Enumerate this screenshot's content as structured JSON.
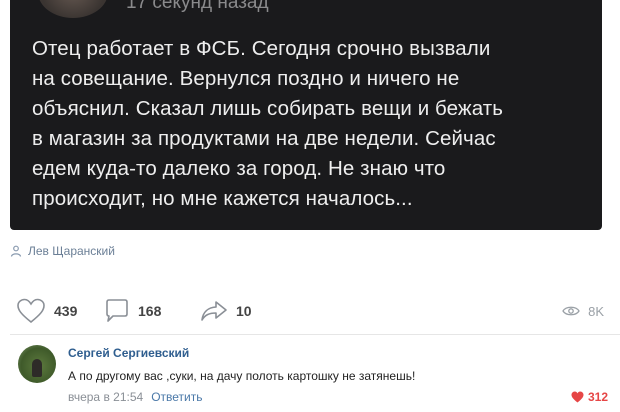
{
  "post": {
    "time": "17 секунд назад",
    "lines": [
      "Отец работает в ФСБ. Сегодня срочно вызвали",
      "на совещание. Вернулся поздно и ничего не",
      "объяснил. Сказал лишь собирать вещи и бежать",
      "в магазин за продуктами на две недели. Сейчас",
      "едем куда-то далеко за город. Не знаю что",
      "происходит, но мне кажется началось..."
    ],
    "author": "Лев Щаранский",
    "author_icon": "person-icon"
  },
  "actions": {
    "likes": "439",
    "comments": "168",
    "reposts": "10",
    "views": "8K",
    "icons": [
      "heart-icon",
      "comment-icon",
      "share-icon",
      "eye-icon"
    ]
  },
  "comment": {
    "author": "Сергей Сергиевский",
    "text": "А по другому вас ,суки, на дачу полоть картошку не затянешь!",
    "time": "вчера в 21:54",
    "reply_label": "Ответить",
    "likes": "312",
    "like_color": "#e64646"
  }
}
